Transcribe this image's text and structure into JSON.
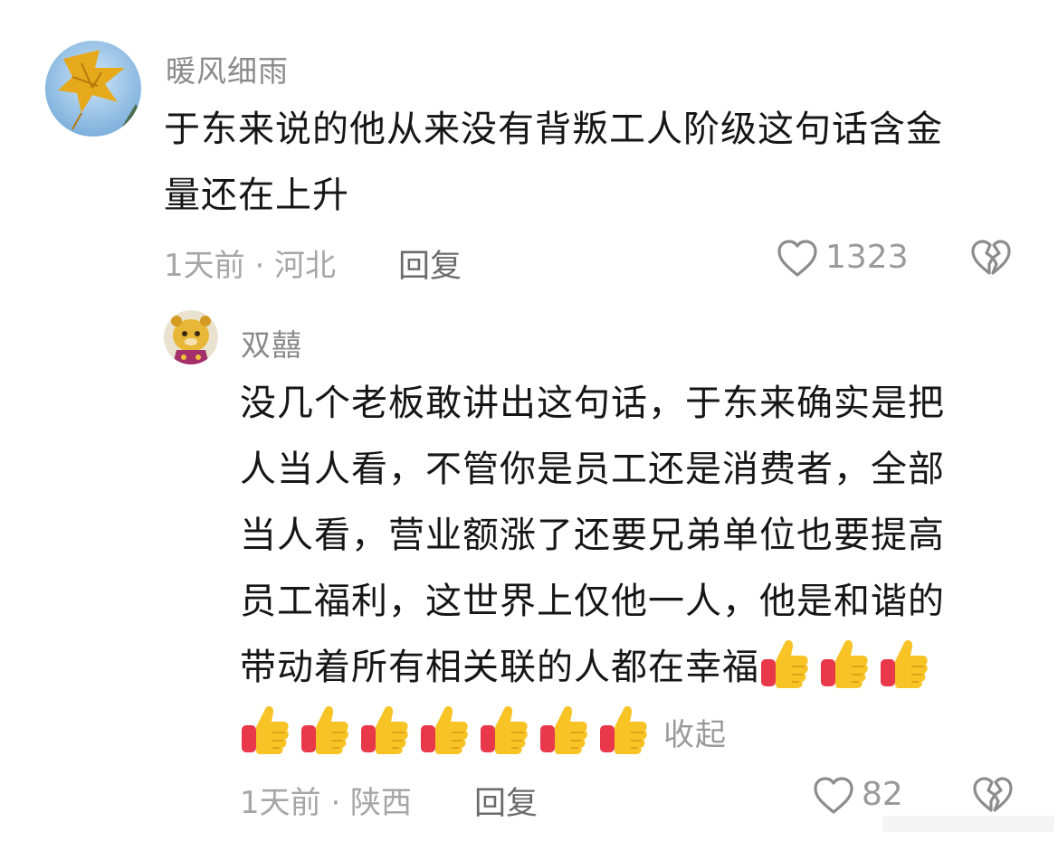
{
  "comments": [
    {
      "author": "暖风细雨",
      "text_lines": [
        "于东来说的他从来没有背叛工人阶级这句话含金",
        "量还在上升"
      ],
      "meta": "1天前 · 河北",
      "reply_label": "回复",
      "like_count": "1323",
      "avatar_icon": "autumn-leaf-avatar"
    },
    {
      "author": "双囍",
      "text_lines": [
        "没几个老板敢讲出这句话，于东来确实是把",
        "人当人看，不管你是员工还是消费者，全部",
        "当人看，营业额涨了还要兄弟单位也要提高",
        "员工福利，这世界上仅他一人，他是和谐的",
        "带动着所有相关联的人都在幸福"
      ],
      "collapse_label": "收起",
      "meta": "1天前 · 陕西",
      "reply_label": "回复",
      "like_count": "82",
      "avatar_icon": "tiger-avatar",
      "thumbs_in_line5": 3,
      "thumbs_in_line6": 7
    }
  ],
  "icons": {
    "like": "heart-outline-icon",
    "dislike": "broken-heart-icon",
    "emoji": "thumbs-up-emoji"
  },
  "colors": {
    "author": "#8a8a8a",
    "text": "#161616",
    "meta": "#a6a6a6",
    "reply": "#6b6b6b",
    "icon_stroke": "#8c8c8c",
    "thumb_yellow": "#f7c325",
    "thumb_red": "#e8384a"
  }
}
